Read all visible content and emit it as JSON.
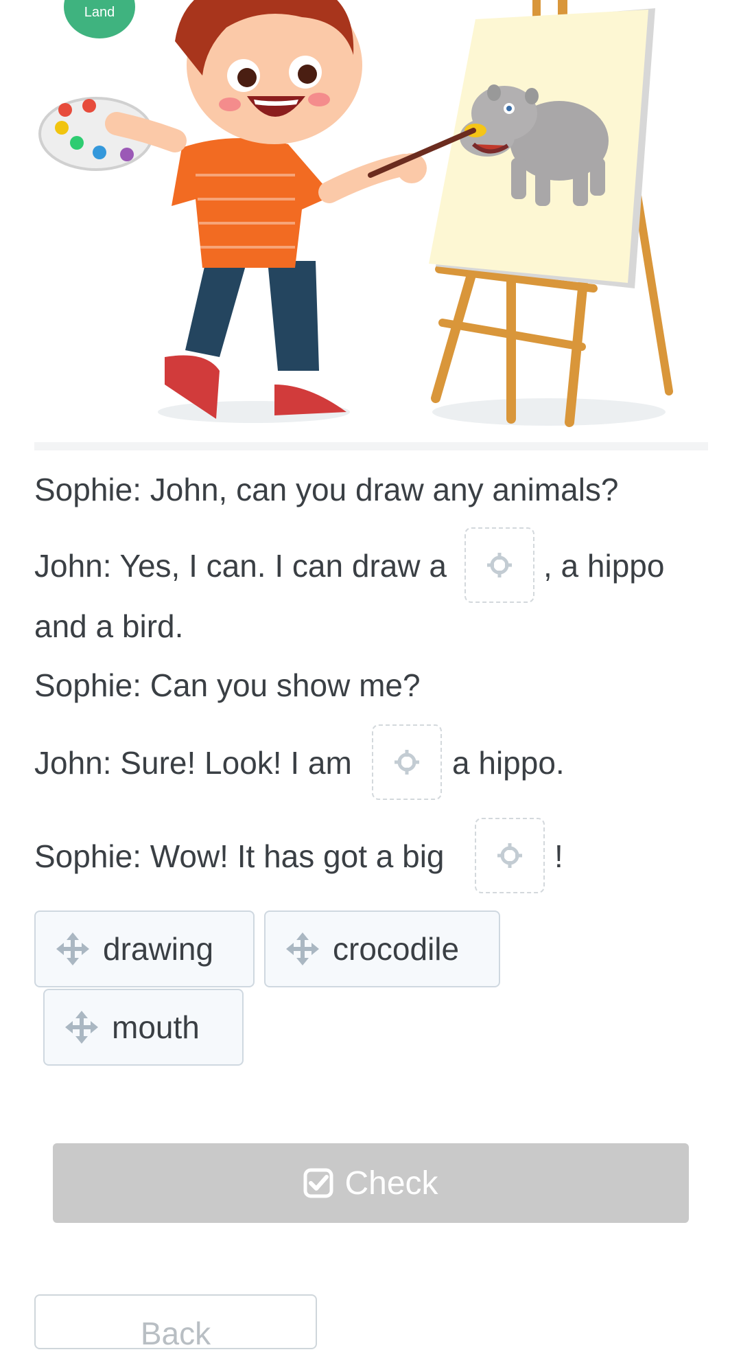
{
  "logo": {
    "text": "Land"
  },
  "dialogue": [
    {
      "before": "Sophie: John, can you draw any animals?"
    },
    {
      "before": "John: Yes, I can. I can draw a",
      "after": ", a hippo"
    },
    {
      "before": "and a bird."
    },
    {
      "before": "Sophie: Can you show me?"
    },
    {
      "before": "John: Sure! Look! I am",
      "after": "a hippo."
    },
    {
      "before": "Sophie: Wow! It has got a big",
      "after": "!"
    }
  ],
  "drop_zone_icon": "crosshair-icon",
  "word_bank": [
    {
      "label": "drawing",
      "icon": "move-icon"
    },
    {
      "label": "crocodile",
      "icon": "move-icon"
    },
    {
      "label": "mouth",
      "icon": "move-icon"
    }
  ],
  "actions": {
    "check_label": "Check",
    "check_icon": "check-square-icon",
    "back_label": "Back",
    "check_color": "#c9c9c9"
  }
}
